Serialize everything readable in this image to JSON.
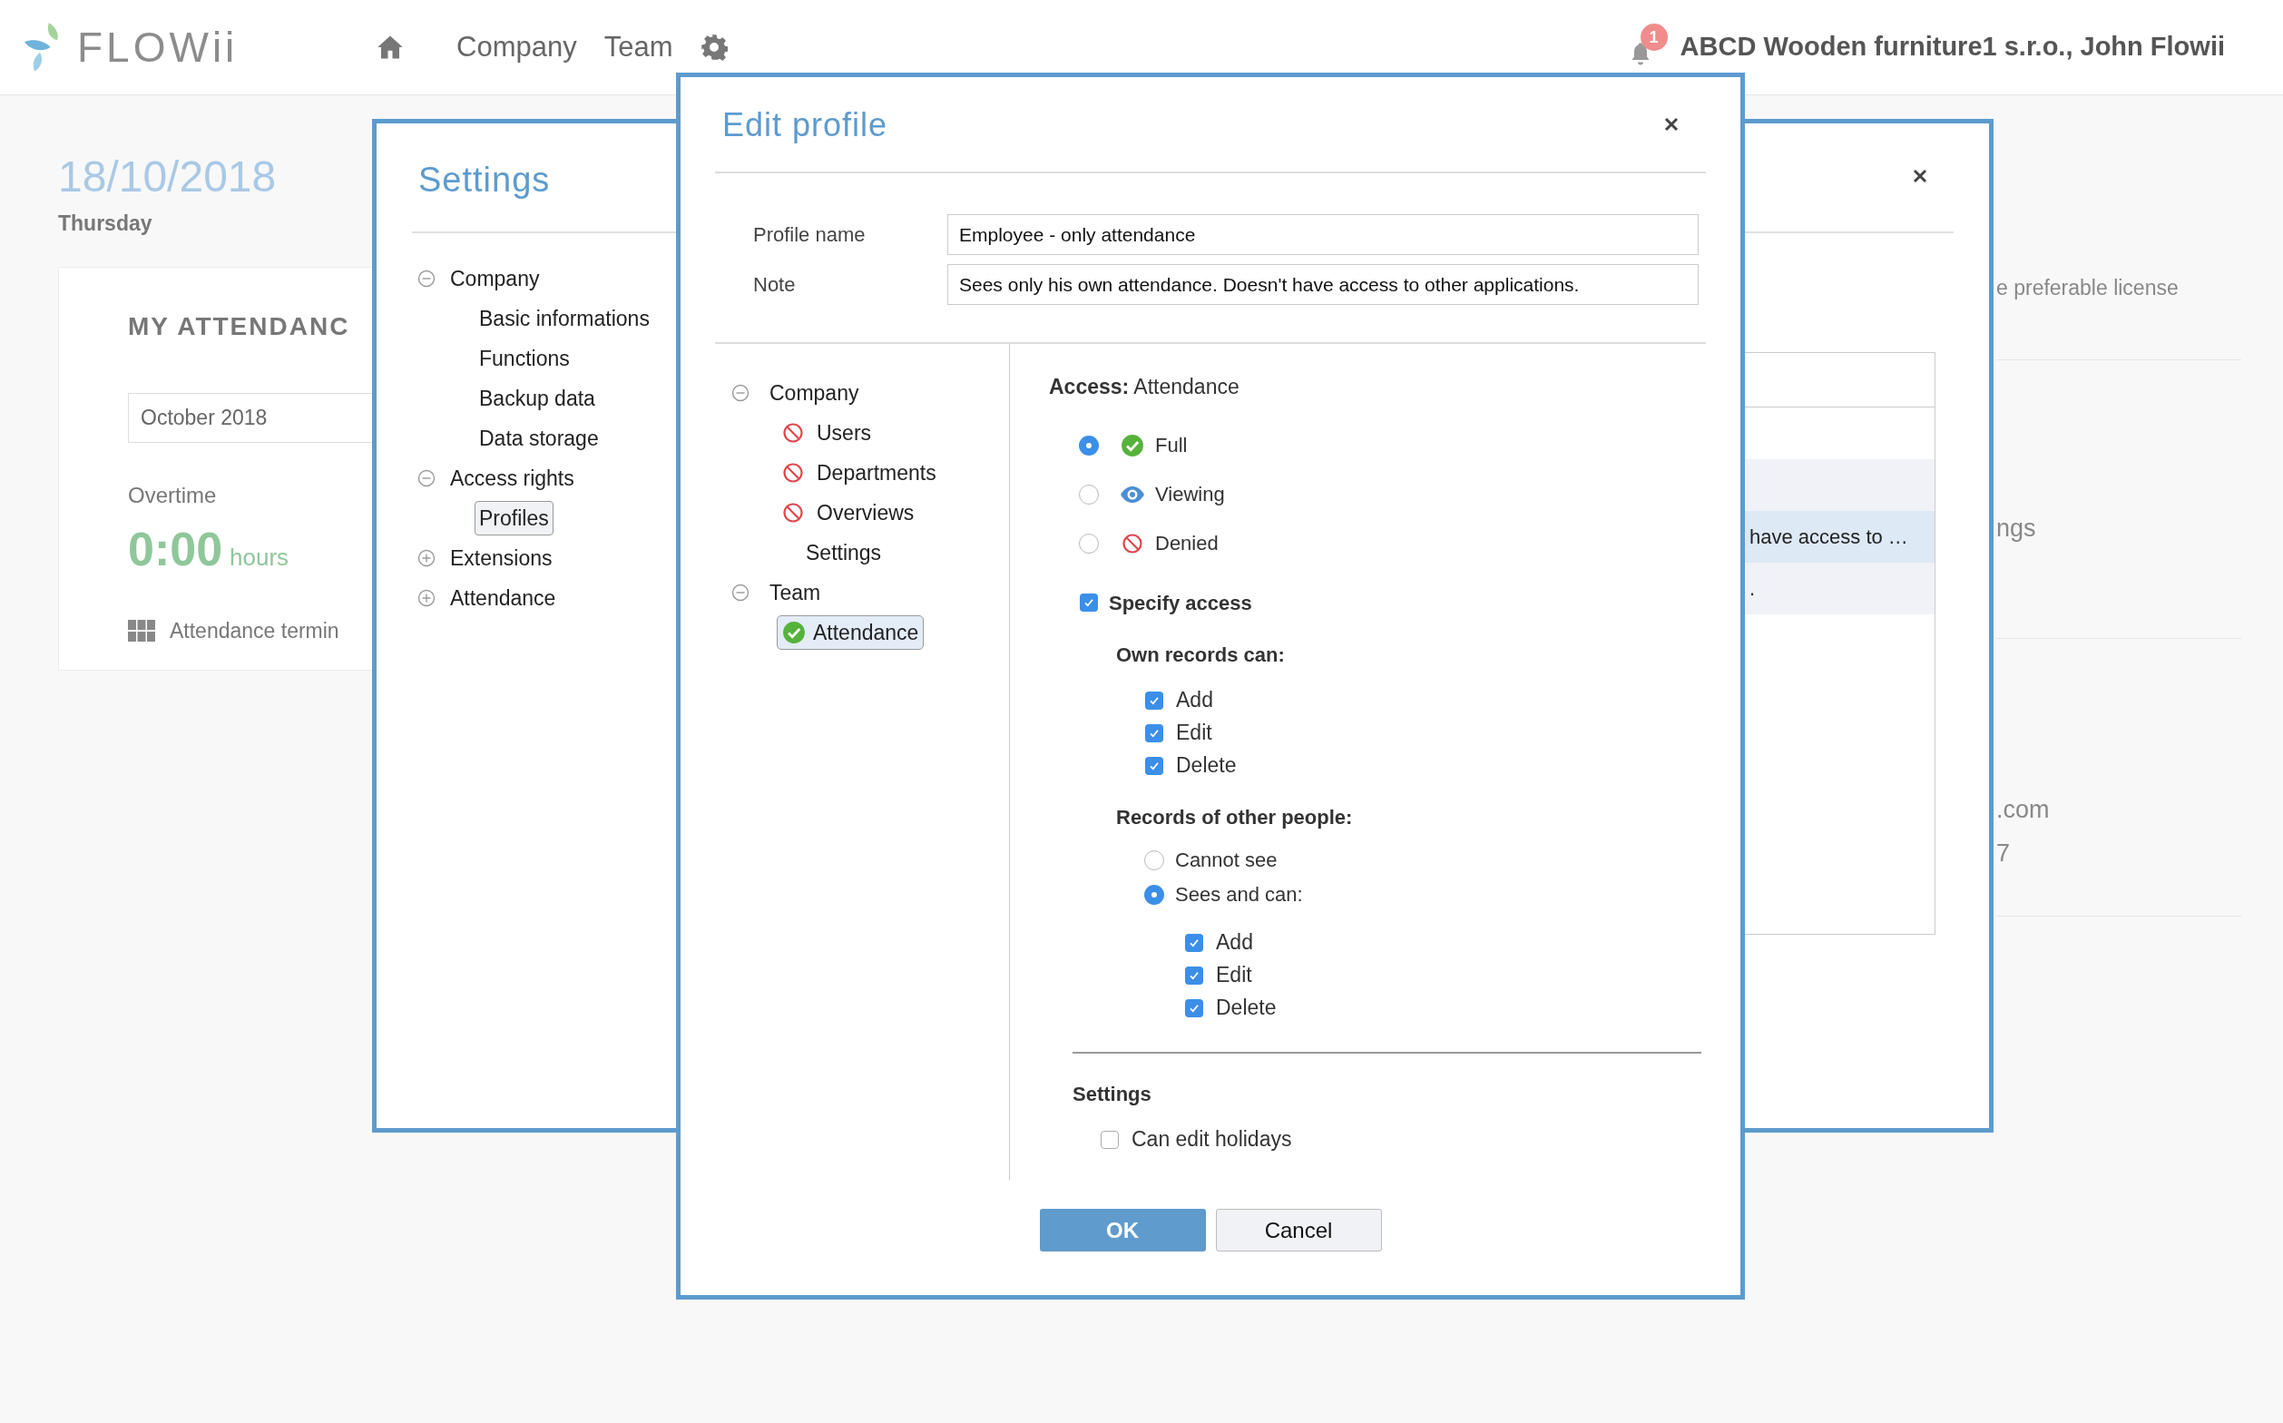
{
  "top_bar": {
    "logo": "FLOWii",
    "nav": [
      {
        "label": "Company"
      },
      {
        "label": "Team"
      }
    ],
    "notification_count": "1",
    "user": "ABCD Wooden furniture1 s.r.o., John Flowii"
  },
  "dashboard": {
    "date": "18/10/2018",
    "weekday": "Thursday",
    "card": {
      "title": "MY ATTENDANC",
      "month": "October 2018",
      "overtime_label": "Overtime",
      "overtime_value": "0:00",
      "overtime_unit": "hours",
      "terminal_link": "Attendance termin"
    }
  },
  "page_fragments": [
    "e preferable license",
    "ngs",
    ".com",
    "7"
  ],
  "settings_dialog": {
    "title": "Settings",
    "tree": [
      {
        "label": "Company",
        "expanded": true,
        "children": [
          {
            "label": "Basic informations",
            "selected": false
          },
          {
            "label": "Functions",
            "selected": false
          },
          {
            "label": "Backup data",
            "selected": false
          },
          {
            "label": "Data storage",
            "selected": false
          }
        ]
      },
      {
        "label": "Access rights",
        "expanded": true,
        "children": [
          {
            "label": "Profiles",
            "selected": true
          }
        ]
      },
      {
        "label": "Extensions",
        "expanded": false
      },
      {
        "label": "Attendance",
        "expanded": false
      }
    ],
    "profiles_table": {
      "rows": [
        {
          "selected": false
        },
        {
          "cell": "have access to …",
          "selected": true
        },
        {
          "cell": ".",
          "selected": false
        }
      ]
    }
  },
  "edit_profile": {
    "title": "Edit profile",
    "fields": [
      {
        "label": "Profile name",
        "value": "Employee - only attendance"
      },
      {
        "label": "Note",
        "value": "Sees only his own attendance. Doesn't have access to other applications."
      }
    ],
    "tree": [
      {
        "label": "Company",
        "expanded": true,
        "children": [
          {
            "label": "Users",
            "kind": "denied",
            "selected": false
          },
          {
            "label": "Departments",
            "kind": "denied",
            "selected": false
          },
          {
            "label": "Overviews",
            "kind": "denied",
            "selected": false
          },
          {
            "label": "Settings",
            "selected": false
          }
        ]
      },
      {
        "label": "Team",
        "expanded": true,
        "children": [
          {
            "label": "Attendance",
            "kind": "full",
            "selected": true
          }
        ]
      }
    ],
    "access": {
      "heading": "Access:",
      "module": "Attendance",
      "levels": [
        {
          "label": "Full",
          "kind": "full",
          "selected": true
        },
        {
          "label": "Viewing",
          "kind": "viewing",
          "selected": false
        },
        {
          "label": "Denied",
          "kind": "denied",
          "selected": false
        }
      ],
      "specify_access": {
        "label": "Specify access",
        "checked": true
      },
      "own_records": {
        "heading": "Own records can:",
        "options": [
          {
            "label": "Add",
            "checked": true
          },
          {
            "label": "Edit",
            "checked": true
          },
          {
            "label": "Delete",
            "checked": true
          }
        ]
      },
      "other_records": {
        "heading": "Records of other people:",
        "choices": [
          {
            "label": "Cannot see",
            "selected": false
          },
          {
            "label": "Sees and can:",
            "selected": true
          }
        ],
        "options": [
          {
            "label": "Add",
            "checked": true
          },
          {
            "label": "Edit",
            "checked": true
          },
          {
            "label": "Delete",
            "checked": true
          }
        ]
      }
    },
    "settings": {
      "heading": "Settings",
      "options": [
        {
          "label": "Can edit holidays",
          "checked": false
        }
      ]
    },
    "buttons": [
      {
        "label": "OK",
        "kind": "primary"
      },
      {
        "label": "Cancel",
        "kind": "secondary"
      }
    ]
  }
}
